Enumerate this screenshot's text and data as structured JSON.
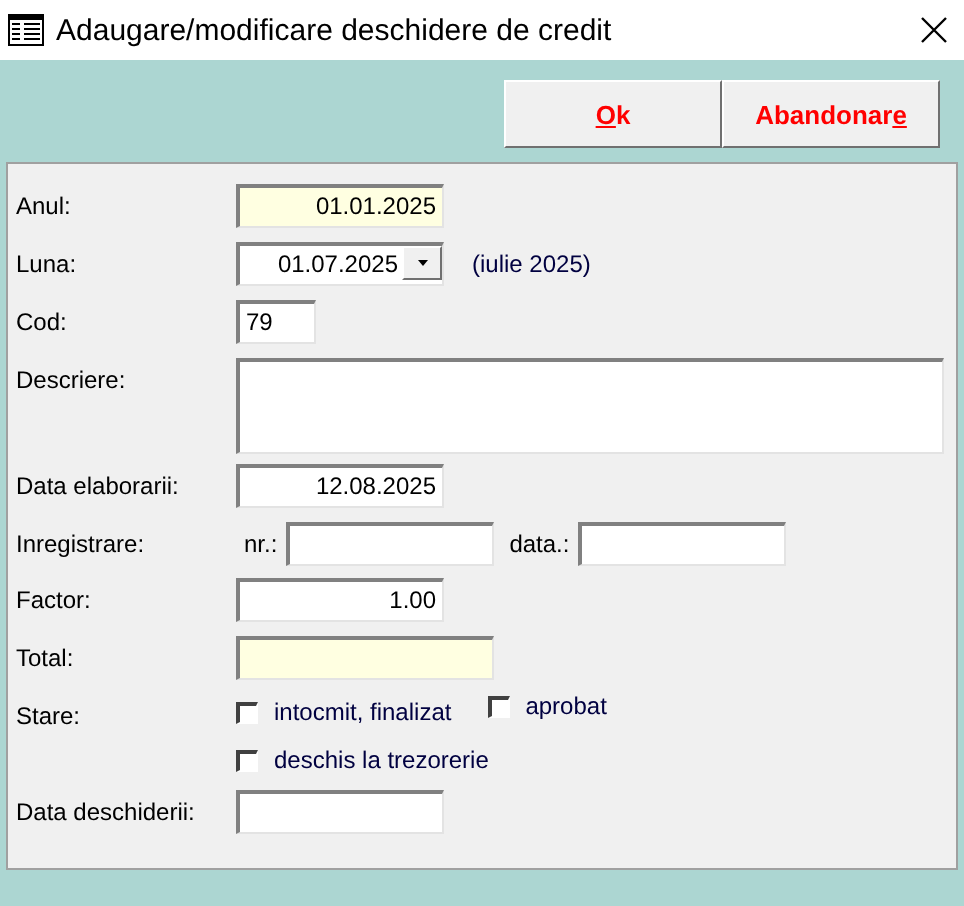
{
  "window": {
    "title": "Adaugare/modificare deschidere de credit"
  },
  "buttons": [
    {
      "mnemonic": "O",
      "after": "k"
    },
    {
      "before": "Abandonar",
      "mnemonic": "e"
    }
  ],
  "rows": [
    {
      "kind": "date",
      "label": "Anul:",
      "value": "01.01.2025",
      "readonly": true
    },
    {
      "kind": "combo",
      "label": "Luna:",
      "value": "01.07.2025",
      "note": "(iulie 2025)"
    },
    {
      "kind": "short",
      "label": "Cod:",
      "value": "79",
      "readonly": false
    },
    {
      "kind": "memo",
      "label": "Descriere:"
    },
    {
      "kind": "date",
      "label": "Data elaborarii:",
      "value": "12.08.2025",
      "readonly": false
    },
    {
      "kind": "pair",
      "label": "Inregistrare:",
      "parts": [
        {
          "label": "nr.:"
        },
        {
          "label": "data.:"
        }
      ]
    },
    {
      "kind": "date",
      "label": "Factor:",
      "value": "1.00",
      "readonly": false
    },
    {
      "kind": "wide",
      "label": "Total:",
      "readonly": true
    },
    {
      "kind": "checks",
      "label": "Stare:",
      "lines": [
        [
          {
            "label": "intocmit, finalizat",
            "checked": false
          },
          {
            "label": "aprobat",
            "checked": false
          }
        ],
        [
          {
            "label": "deschis la trezorerie",
            "checked": false
          }
        ]
      ]
    },
    {
      "kind": "date",
      "label": "Data deschiderii:",
      "readonly": false
    }
  ]
}
